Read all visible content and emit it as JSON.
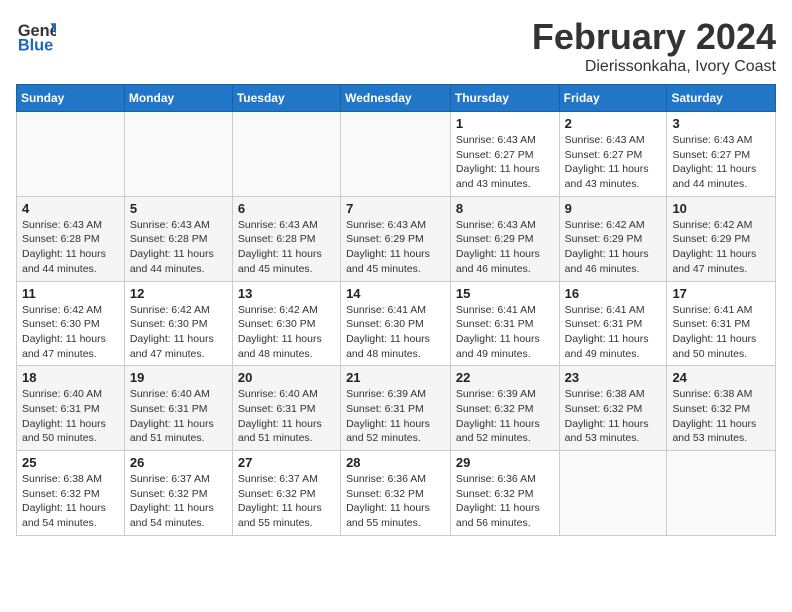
{
  "header": {
    "logo_line1": "General",
    "logo_line2": "Blue",
    "title": "February 2024",
    "subtitle": "Dierissonkaha, Ivory Coast"
  },
  "calendar": {
    "days_of_week": [
      "Sunday",
      "Monday",
      "Tuesday",
      "Wednesday",
      "Thursday",
      "Friday",
      "Saturday"
    ],
    "weeks": [
      [
        {
          "day": "",
          "info": ""
        },
        {
          "day": "",
          "info": ""
        },
        {
          "day": "",
          "info": ""
        },
        {
          "day": "",
          "info": ""
        },
        {
          "day": "1",
          "info": "Sunrise: 6:43 AM\nSunset: 6:27 PM\nDaylight: 11 hours\nand 43 minutes."
        },
        {
          "day": "2",
          "info": "Sunrise: 6:43 AM\nSunset: 6:27 PM\nDaylight: 11 hours\nand 43 minutes."
        },
        {
          "day": "3",
          "info": "Sunrise: 6:43 AM\nSunset: 6:27 PM\nDaylight: 11 hours\nand 44 minutes."
        }
      ],
      [
        {
          "day": "4",
          "info": "Sunrise: 6:43 AM\nSunset: 6:28 PM\nDaylight: 11 hours\nand 44 minutes."
        },
        {
          "day": "5",
          "info": "Sunrise: 6:43 AM\nSunset: 6:28 PM\nDaylight: 11 hours\nand 44 minutes."
        },
        {
          "day": "6",
          "info": "Sunrise: 6:43 AM\nSunset: 6:28 PM\nDaylight: 11 hours\nand 45 minutes."
        },
        {
          "day": "7",
          "info": "Sunrise: 6:43 AM\nSunset: 6:29 PM\nDaylight: 11 hours\nand 45 minutes."
        },
        {
          "day": "8",
          "info": "Sunrise: 6:43 AM\nSunset: 6:29 PM\nDaylight: 11 hours\nand 46 minutes."
        },
        {
          "day": "9",
          "info": "Sunrise: 6:42 AM\nSunset: 6:29 PM\nDaylight: 11 hours\nand 46 minutes."
        },
        {
          "day": "10",
          "info": "Sunrise: 6:42 AM\nSunset: 6:29 PM\nDaylight: 11 hours\nand 47 minutes."
        }
      ],
      [
        {
          "day": "11",
          "info": "Sunrise: 6:42 AM\nSunset: 6:30 PM\nDaylight: 11 hours\nand 47 minutes."
        },
        {
          "day": "12",
          "info": "Sunrise: 6:42 AM\nSunset: 6:30 PM\nDaylight: 11 hours\nand 47 minutes."
        },
        {
          "day": "13",
          "info": "Sunrise: 6:42 AM\nSunset: 6:30 PM\nDaylight: 11 hours\nand 48 minutes."
        },
        {
          "day": "14",
          "info": "Sunrise: 6:41 AM\nSunset: 6:30 PM\nDaylight: 11 hours\nand 48 minutes."
        },
        {
          "day": "15",
          "info": "Sunrise: 6:41 AM\nSunset: 6:31 PM\nDaylight: 11 hours\nand 49 minutes."
        },
        {
          "day": "16",
          "info": "Sunrise: 6:41 AM\nSunset: 6:31 PM\nDaylight: 11 hours\nand 49 minutes."
        },
        {
          "day": "17",
          "info": "Sunrise: 6:41 AM\nSunset: 6:31 PM\nDaylight: 11 hours\nand 50 minutes."
        }
      ],
      [
        {
          "day": "18",
          "info": "Sunrise: 6:40 AM\nSunset: 6:31 PM\nDaylight: 11 hours\nand 50 minutes."
        },
        {
          "day": "19",
          "info": "Sunrise: 6:40 AM\nSunset: 6:31 PM\nDaylight: 11 hours\nand 51 minutes."
        },
        {
          "day": "20",
          "info": "Sunrise: 6:40 AM\nSunset: 6:31 PM\nDaylight: 11 hours\nand 51 minutes."
        },
        {
          "day": "21",
          "info": "Sunrise: 6:39 AM\nSunset: 6:31 PM\nDaylight: 11 hours\nand 52 minutes."
        },
        {
          "day": "22",
          "info": "Sunrise: 6:39 AM\nSunset: 6:32 PM\nDaylight: 11 hours\nand 52 minutes."
        },
        {
          "day": "23",
          "info": "Sunrise: 6:38 AM\nSunset: 6:32 PM\nDaylight: 11 hours\nand 53 minutes."
        },
        {
          "day": "24",
          "info": "Sunrise: 6:38 AM\nSunset: 6:32 PM\nDaylight: 11 hours\nand 53 minutes."
        }
      ],
      [
        {
          "day": "25",
          "info": "Sunrise: 6:38 AM\nSunset: 6:32 PM\nDaylight: 11 hours\nand 54 minutes."
        },
        {
          "day": "26",
          "info": "Sunrise: 6:37 AM\nSunset: 6:32 PM\nDaylight: 11 hours\nand 54 minutes."
        },
        {
          "day": "27",
          "info": "Sunrise: 6:37 AM\nSunset: 6:32 PM\nDaylight: 11 hours\nand 55 minutes."
        },
        {
          "day": "28",
          "info": "Sunrise: 6:36 AM\nSunset: 6:32 PM\nDaylight: 11 hours\nand 55 minutes."
        },
        {
          "day": "29",
          "info": "Sunrise: 6:36 AM\nSunset: 6:32 PM\nDaylight: 11 hours\nand 56 minutes."
        },
        {
          "day": "",
          "info": ""
        },
        {
          "day": "",
          "info": ""
        }
      ]
    ]
  }
}
